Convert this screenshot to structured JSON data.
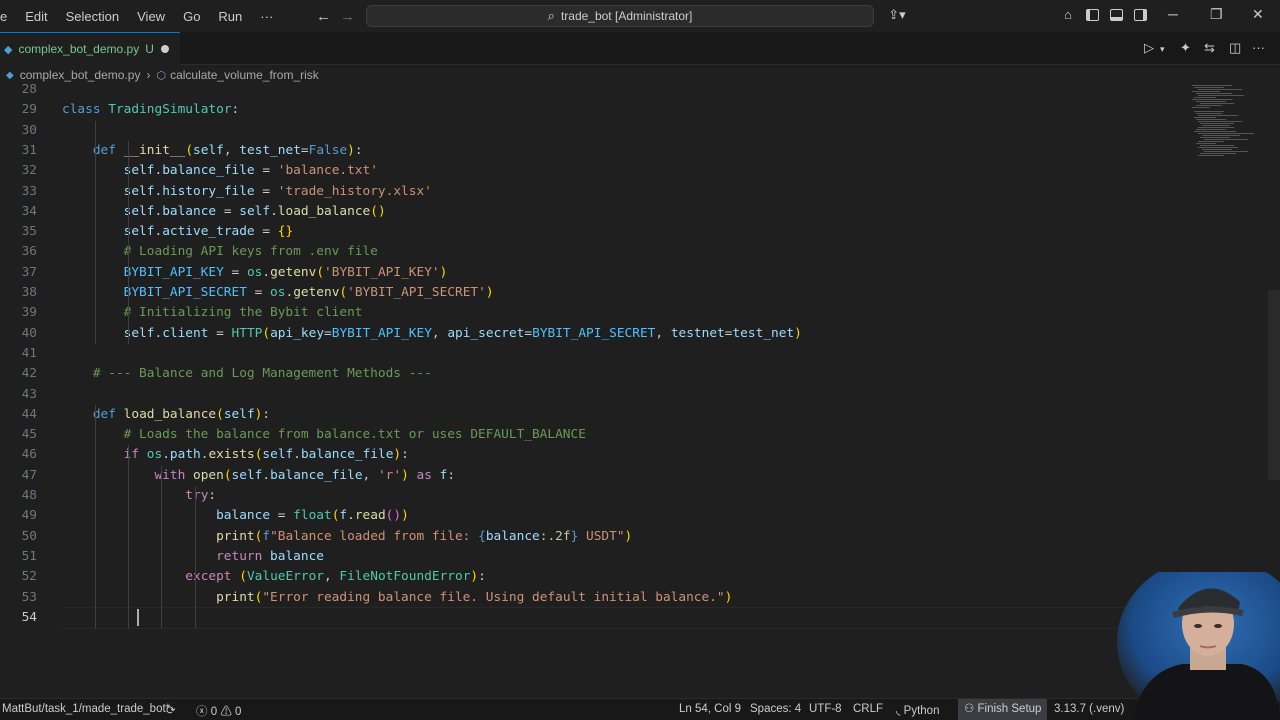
{
  "menu": {
    "items": [
      "e",
      "Edit",
      "Selection",
      "View",
      "Go",
      "Run",
      "···"
    ]
  },
  "command_center": {
    "label": "trade_bot [Administrator]"
  },
  "tab": {
    "filename": "complex_bot_demo.py",
    "status": "U"
  },
  "breadcrumb": {
    "file": "complex_bot_demo.py",
    "symbol": "calculate_volume_from_risk"
  },
  "editor": {
    "lines": [
      {
        "n": "28",
        "html": ""
      },
      {
        "n": "29",
        "html": "<span class='kw'>class</span> <span class='cls'>TradingSimulator</span>:"
      },
      {
        "n": "30",
        "html": ""
      },
      {
        "n": "31",
        "html": "    <span class='kw'>def</span> <span class='fnc'>__init__</span><span class='brk'>(</span><span class='var'>self</span>, <span class='var'>test_net</span>=<span class='kw'>False</span><span class='brk'>)</span>:"
      },
      {
        "n": "32",
        "html": "        <span class='var'>self</span>.<span class='var'>balance_file</span> = <span class='str'>'balance.txt'</span>"
      },
      {
        "n": "33",
        "html": "        <span class='var'>self</span>.<span class='var'>history_file</span> = <span class='str'>'trade_history.xlsx'</span>"
      },
      {
        "n": "34",
        "html": "        <span class='var'>self</span>.<span class='var'>balance</span> = <span class='var'>self</span>.<span class='fnc'>load_balance</span><span class='brk'>()</span>"
      },
      {
        "n": "35",
        "html": "        <span class='var'>self</span>.<span class='var'>active_trade</span> = <span class='brk'>{}</span>"
      },
      {
        "n": "36",
        "html": "        <span class='cmt'># Loading API keys from .env file</span>"
      },
      {
        "n": "37",
        "html": "        <span class='con'>BYBIT_API_KEY</span> = <span class='cls'>os</span>.<span class='fnc'>getenv</span><span class='brk'>(</span><span class='str'>'BYBIT_API_KEY'</span><span class='brk'>)</span>"
      },
      {
        "n": "38",
        "html": "        <span class='con'>BYBIT_API_SECRET</span> = <span class='cls'>os</span>.<span class='fnc'>getenv</span><span class='brk'>(</span><span class='str'>'BYBIT_API_SECRET'</span><span class='brk'>)</span>"
      },
      {
        "n": "39",
        "html": "        <span class='cmt'># Initializing the Bybit client</span>"
      },
      {
        "n": "40",
        "html": "        <span class='var'>self</span>.<span class='var'>client</span> = <span class='cls'>HTTP</span><span class='brk'>(</span><span class='var'>api_key</span>=<span class='con'>BYBIT_API_KEY</span>, <span class='var'>api_secret</span>=<span class='con'>BYBIT_API_SECRET</span>, <span class='var'>testnet</span>=<span class='var'>test_net</span><span class='brk'>)</span>"
      },
      {
        "n": "41",
        "html": ""
      },
      {
        "n": "42",
        "html": "    <span class='cmt'># --- Balance and Log Management Methods ---</span>"
      },
      {
        "n": "43",
        "html": ""
      },
      {
        "n": "44",
        "html": "    <span class='kw'>def</span> <span class='fnc'>load_balance</span><span class='brk'>(</span><span class='var'>self</span><span class='brk'>)</span>:"
      },
      {
        "n": "45",
        "html": "        <span class='cmt'># Loads the balance from balance.txt or uses DEFAULT_BALANCE</span>"
      },
      {
        "n": "46",
        "html": "        <span class='kw2'>if</span> <span class='cls'>os</span>.<span class='var'>path</span>.<span class='fnc'>exists</span><span class='brk'>(</span><span class='var'>self</span>.<span class='var'>balance_file</span><span class='brk'>)</span>:"
      },
      {
        "n": "47",
        "html": "            <span class='kw2'>with</span> <span class='fnc'>open</span><span class='brk'>(</span><span class='var'>self</span>.<span class='var'>balance_file</span>, <span class='str'>'r'</span><span class='brk'>)</span> <span class='kw2'>as</span> <span class='var'>f</span>:"
      },
      {
        "n": "48",
        "html": "                <span class='kw2'>try</span>:"
      },
      {
        "n": "49",
        "html": "                    <span class='var'>balance</span> = <span class='cls'>float</span><span class='brk'>(</span><span class='var'>f</span>.<span class='fnc'>read</span><span class='brk2'>()</span><span class='brk'>)</span>"
      },
      {
        "n": "50",
        "html": "                    <span class='fnc'>print</span><span class='brk'>(</span><span class='kw'>f</span><span class='str'>\"Balance loaded from file: </span><span class='fmt'>{</span><span class='var'>balance</span><span class='num'>:.2f</span><span class='fmt'>}</span><span class='str'> USDT\"</span><span class='brk'>)</span>"
      },
      {
        "n": "51",
        "html": "                    <span class='kw2'>return</span> <span class='var'>balance</span>"
      },
      {
        "n": "52",
        "html": "                <span class='kw2'>except</span> <span class='brk'>(</span><span class='cls'>ValueError</span>, <span class='cls'>FileNotFoundError</span><span class='brk'>)</span>:"
      },
      {
        "n": "53",
        "html": "                    <span class='fnc'>print</span><span class='brk'>(</span><span class='str'>\"Error reading balance file. Using default initial balance.\"</span><span class='brk'>)</span>"
      },
      {
        "n": "54",
        "html": "        "
      }
    ]
  },
  "status": {
    "branch": "MattBut/task_1/made_trade_bot*",
    "errors": "0",
    "warnings": "0",
    "position": "Ln 54, Col 9",
    "spaces": "Spaces: 4",
    "encoding": "UTF-8",
    "eol": "CRLF",
    "language": "Python",
    "finish": "Finish Setup",
    "interpreter": "3.13.7 (.venv)"
  },
  "colors": {
    "accent": "#0078d4",
    "untracked": "#73c991",
    "background": "#1f1f1f"
  }
}
